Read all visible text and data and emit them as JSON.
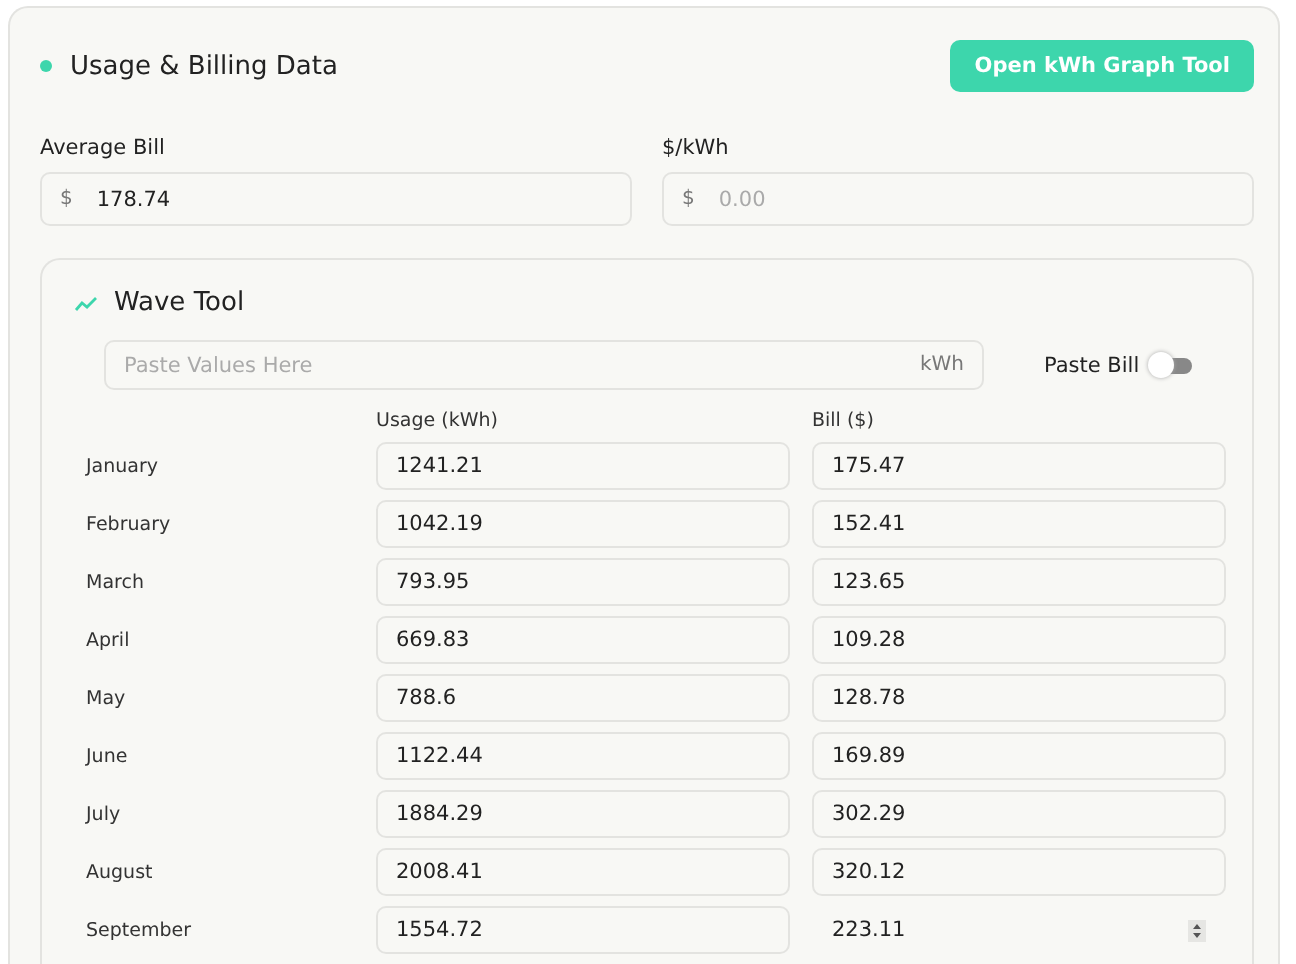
{
  "header": {
    "title": "Usage & Billing Data",
    "button": "Open kWh Graph Tool"
  },
  "fields": [
    {
      "label": "Average Bill",
      "prefix": "$",
      "value": "178.74"
    },
    {
      "label": "$/kWh",
      "prefix": "$",
      "placeholder": "0.00"
    }
  ],
  "wave_tool": {
    "title": "Wave Tool",
    "paste": {
      "placeholder": "Paste Values Here",
      "unit": "kWh"
    },
    "toggle": {
      "label": "Paste Bill",
      "on": false
    },
    "columns": [
      "Usage (kWh)",
      "Bill ($)"
    ],
    "rows": [
      {
        "month": "January",
        "usage": "1241.21",
        "bill": "175.47",
        "hovered": false
      },
      {
        "month": "February",
        "usage": "1042.19",
        "bill": "152.41",
        "hovered": false
      },
      {
        "month": "March",
        "usage": "793.95",
        "bill": "123.65",
        "hovered": false
      },
      {
        "month": "April",
        "usage": "669.83",
        "bill": "109.28",
        "hovered": false
      },
      {
        "month": "May",
        "usage": "788.6",
        "bill": "128.78",
        "hovered": false
      },
      {
        "month": "June",
        "usage": "1122.44",
        "bill": "169.89",
        "hovered": false
      },
      {
        "month": "July",
        "usage": "1884.29",
        "bill": "302.29",
        "hovered": false
      },
      {
        "month": "August",
        "usage": "2008.41",
        "bill": "320.12",
        "hovered": false
      },
      {
        "month": "September",
        "usage": "1554.72",
        "bill": "223.11",
        "hovered": true
      }
    ]
  }
}
